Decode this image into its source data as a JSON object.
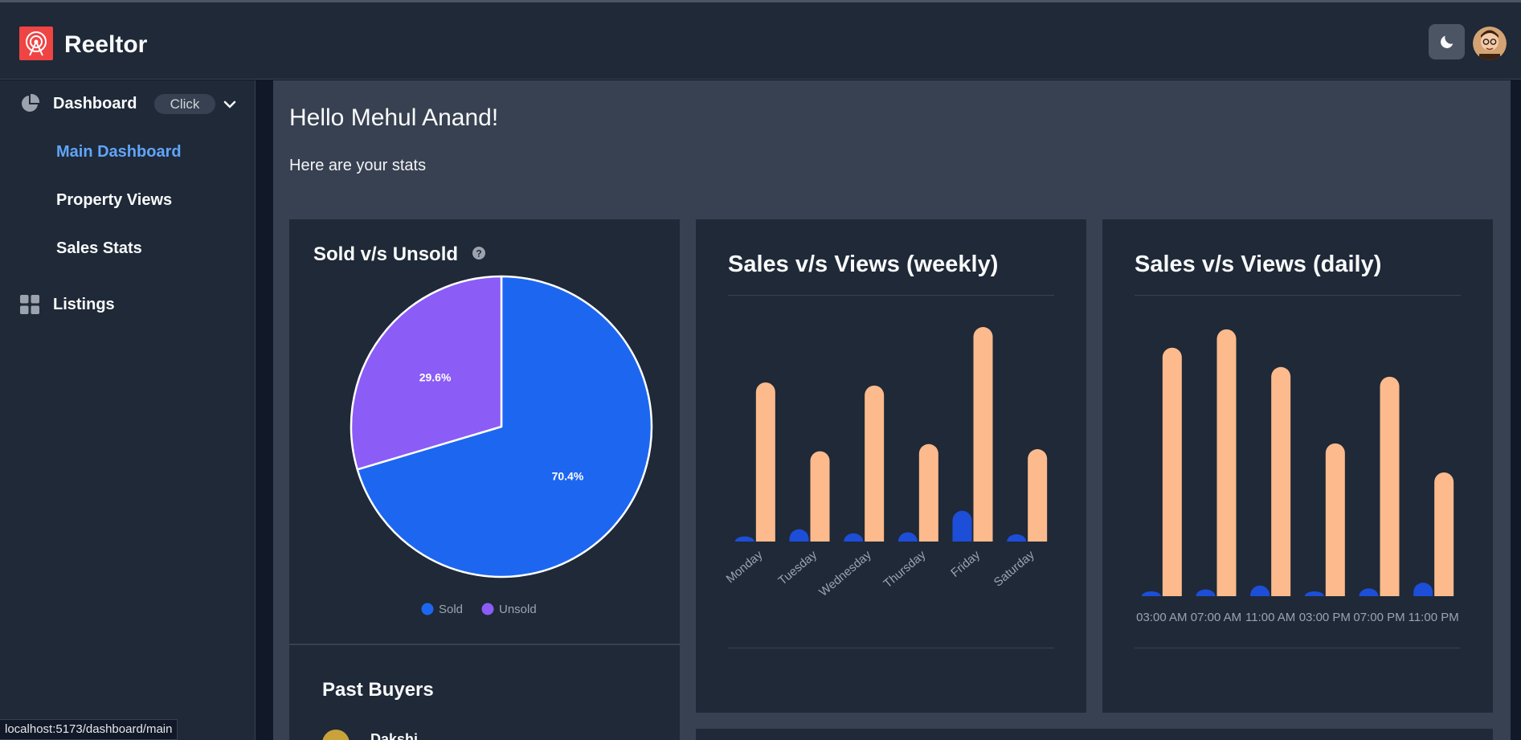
{
  "app": {
    "name": "Reeltor"
  },
  "header": {
    "theme_icon": "moon-icon",
    "avatar_icon": "user-avatar"
  },
  "sidebar": {
    "dashboard": {
      "label": "Dashboard",
      "badge": "Click",
      "icon": "pie-chart-icon"
    },
    "sub_items": [
      {
        "label": "Main Dashboard",
        "active": true
      },
      {
        "label": "Property Views",
        "active": false
      },
      {
        "label": "Sales Stats",
        "active": false
      }
    ],
    "listings": {
      "label": "Listings",
      "icon": "grid-icon"
    }
  },
  "main": {
    "greeting": "Hello Mehul Anand!",
    "subtitle": "Here are your stats"
  },
  "cards": {
    "pie": {
      "title": "Sold v/s Unsold"
    },
    "weekly": {
      "title": "Sales v/s Views (weekly)"
    },
    "daily": {
      "title": "Sales v/s Views (daily)"
    },
    "buyers": {
      "title": "Past Buyers",
      "first_buyer": "Dakshi"
    }
  },
  "chart_data": [
    {
      "id": "sold-unsold",
      "type": "pie",
      "labels": [
        "Sold",
        "Unsold"
      ],
      "values": [
        70.4,
        29.6
      ],
      "value_labels": [
        "70.4%",
        "29.6%"
      ],
      "colors": [
        "#1d67f0",
        "#8b5cf6"
      ],
      "legend": "bottom"
    },
    {
      "id": "weekly",
      "type": "bar",
      "categories": [
        "Monday",
        "Tuesday",
        "Wednesday",
        "Thursday",
        "Friday",
        "Saturday"
      ],
      "series": [
        {
          "values": [
            5,
            12,
            8,
            9,
            30,
            7
          ],
          "color": "#1d4ed8"
        },
        {
          "values": [
            155,
            88,
            152,
            95,
            209,
            90
          ],
          "color": "#fdba8c"
        }
      ],
      "ylim": [
        0,
        220
      ],
      "grid": false
    },
    {
      "id": "daily",
      "type": "bar",
      "categories": [
        "03:00 AM",
        "07:00 AM",
        "11:00 AM",
        "03:00 PM",
        "07:00 PM",
        "11:00 PM"
      ],
      "series": [
        {
          "values": [
            3,
            7,
            11,
            2,
            8,
            14
          ],
          "color": "#1d4ed8"
        },
        {
          "values": [
            257,
            276,
            237,
            158,
            227,
            128
          ],
          "color": "#fdba8c"
        }
      ],
      "ylim": [
        0,
        290
      ],
      "grid": false
    }
  ],
  "statusbar": {
    "url": "localhost:5173/dashboard/main"
  }
}
